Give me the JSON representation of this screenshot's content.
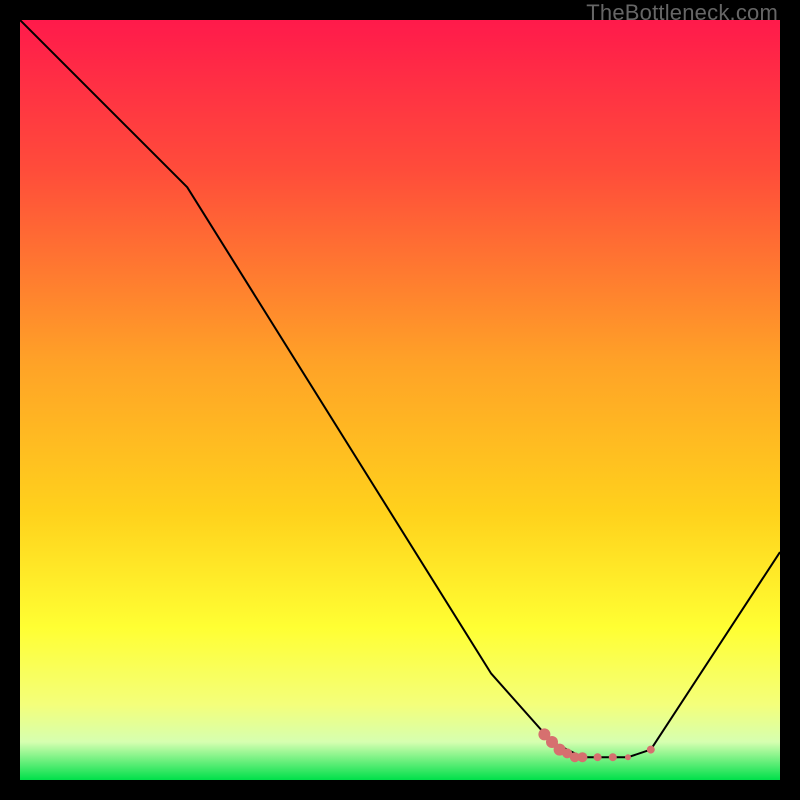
{
  "watermark": "TheBottleneck.com",
  "chart_data": {
    "type": "line",
    "title": "",
    "xlabel": "",
    "ylabel": "",
    "xlim": [
      0,
      100
    ],
    "ylim": [
      0,
      100
    ],
    "grid": false,
    "legend": false,
    "background_gradient": {
      "stops": [
        {
          "offset": 0.0,
          "color": "#ff1a4b"
        },
        {
          "offset": 0.2,
          "color": "#ff4d3a"
        },
        {
          "offset": 0.45,
          "color": "#ffa227"
        },
        {
          "offset": 0.65,
          "color": "#ffd21c"
        },
        {
          "offset": 0.8,
          "color": "#ffff33"
        },
        {
          "offset": 0.9,
          "color": "#f4ff7a"
        },
        {
          "offset": 0.95,
          "color": "#d6ffb0"
        },
        {
          "offset": 1.0,
          "color": "#00e04a"
        }
      ]
    },
    "series": [
      {
        "name": "bottleneck-curve",
        "stroke": "#000000",
        "stroke_width": 2,
        "x": [
          0,
          22,
          62,
          70,
          74,
          78,
          80,
          83,
          100
        ],
        "y": [
          100,
          78,
          14,
          5,
          3,
          3,
          3,
          4,
          30
        ]
      }
    ],
    "markers": {
      "name": "sweet-spot",
      "color": "#d6706f",
      "points": [
        {
          "x": 69,
          "y": 6,
          "r": 6
        },
        {
          "x": 70,
          "y": 5,
          "r": 6
        },
        {
          "x": 71,
          "y": 4,
          "r": 6
        },
        {
          "x": 72,
          "y": 3.5,
          "r": 5
        },
        {
          "x": 73,
          "y": 3,
          "r": 5
        },
        {
          "x": 74,
          "y": 3,
          "r": 5
        },
        {
          "x": 76,
          "y": 3,
          "r": 4
        },
        {
          "x": 78,
          "y": 3,
          "r": 4
        },
        {
          "x": 80,
          "y": 3,
          "r": 3
        },
        {
          "x": 83,
          "y": 4,
          "r": 4
        }
      ]
    }
  }
}
